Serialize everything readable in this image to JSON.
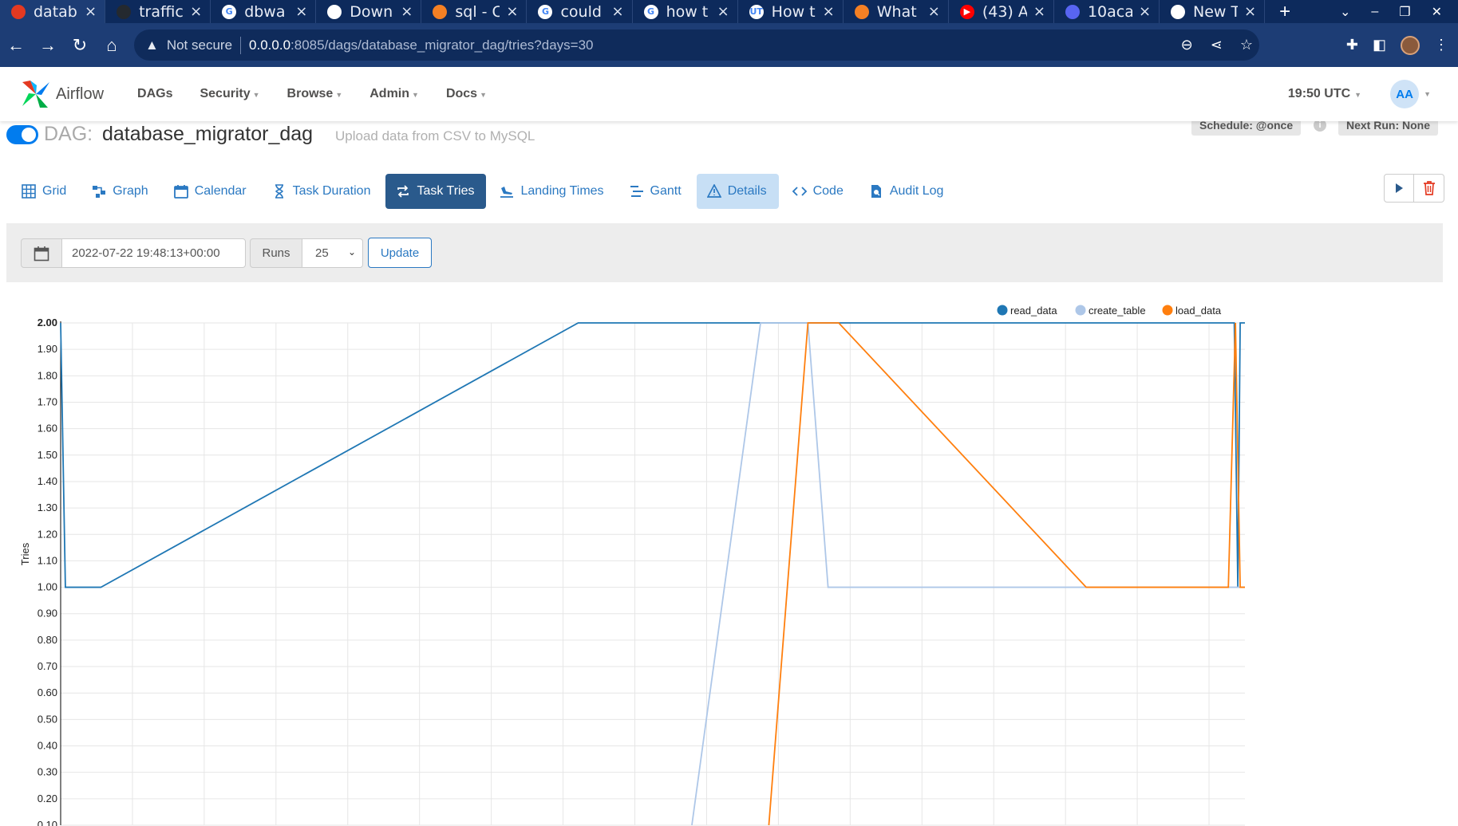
{
  "browser": {
    "tabs": [
      {
        "title": "datab",
        "fav_color": "#e43921",
        "fav_text": ""
      },
      {
        "title": "traffic",
        "fav_color": "#24292f",
        "fav_text": ""
      },
      {
        "title": "dbwa",
        "fav_color": "#ffffff",
        "fav_text": "G"
      },
      {
        "title": "Down",
        "fav_color": "#ffffff",
        "fav_text": ""
      },
      {
        "title": "sql - C",
        "fav_color": "#f48024",
        "fav_text": ""
      },
      {
        "title": "could",
        "fav_color": "#ffffff",
        "fav_text": "G"
      },
      {
        "title": "how t",
        "fav_color": "#ffffff",
        "fav_text": "G"
      },
      {
        "title": "How t",
        "fav_color": "#ffffff",
        "fav_text": "UT"
      },
      {
        "title": "What",
        "fav_color": "#f48024",
        "fav_text": ""
      },
      {
        "title": "(43) A",
        "fav_color": "#ff0000",
        "fav_text": "▶"
      },
      {
        "title": "10aca",
        "fav_color": "#5865f2",
        "fav_text": ""
      },
      {
        "title": "New T",
        "fav_color": "#ffffff",
        "fav_text": ""
      }
    ],
    "address": {
      "security": "Not secure",
      "host": "0.0.0.0",
      "path": ":8085/dags/database_migrator_dag/tries?days=30"
    }
  },
  "header": {
    "logo_text": "Airflow",
    "menu": [
      "DAGs",
      "Security",
      "Browse",
      "Admin",
      "Docs"
    ],
    "clock": "19:50 UTC",
    "avatar": "AA"
  },
  "dag": {
    "prefix": "DAG:",
    "name": "database_migrator_dag",
    "description": "Upload data from CSV to MySQL",
    "schedule": "Schedule: @once",
    "info": "i",
    "next_run": "Next Run: None"
  },
  "tabs": [
    {
      "label": "Grid",
      "icon": "grid-icon"
    },
    {
      "label": "Graph",
      "icon": "graph-icon"
    },
    {
      "label": "Calendar",
      "icon": "calendar-icon"
    },
    {
      "label": "Task Duration",
      "icon": "hourglass-icon"
    },
    {
      "label": "Task Tries",
      "icon": "retry-icon"
    },
    {
      "label": "Landing Times",
      "icon": "landing-icon"
    },
    {
      "label": "Gantt",
      "icon": "gantt-icon"
    },
    {
      "label": "Details",
      "icon": "warning-icon"
    },
    {
      "label": "Code",
      "icon": "code-icon"
    },
    {
      "label": "Audit Log",
      "icon": "audit-icon"
    }
  ],
  "filter": {
    "base_date": "2022-07-22 19:48:13+00:00",
    "runs_label": "Runs",
    "runs_value": "25",
    "update_label": "Update"
  },
  "colors": {
    "accent": "#017cee",
    "active_tab": "#2a5a8c",
    "details_tab": "#c7dff5",
    "read_data": "#1f77b4",
    "create_table": "#aec7e8",
    "load_data": "#ff7f0e"
  },
  "chart_data": {
    "type": "line",
    "ylabel": "Tries",
    "ylim": [
      0.1,
      2.0
    ],
    "yticks": [
      "2.00",
      "1.90",
      "1.80",
      "1.70",
      "1.60",
      "1.50",
      "1.40",
      "1.30",
      "1.20",
      "1.10",
      "1.00",
      "0.90",
      "0.80",
      "0.70",
      "0.60",
      "0.50",
      "0.40",
      "0.30",
      "0.20",
      "0.10"
    ],
    "legend_position": "top-right",
    "grid": true,
    "series": [
      {
        "name": "read_data",
        "color": "#1f77b4",
        "points": [
          [
            0.0,
            2.0
          ],
          [
            0.4,
            1.0
          ],
          [
            3.4,
            1.0
          ],
          [
            43.7,
            2.0
          ],
          [
            99.1,
            2.0
          ],
          [
            99.4,
            1.0
          ],
          [
            99.6,
            2.0
          ],
          [
            100,
            2.0
          ]
        ]
      },
      {
        "name": "create_table",
        "color": "#aec7e8",
        "points": [
          [
            53.3,
            0.1
          ],
          [
            59.1,
            2.0
          ],
          [
            63.1,
            2.0
          ],
          [
            64.8,
            1.0
          ],
          [
            99.4,
            1.0
          ],
          [
            100,
            1.0
          ]
        ]
      },
      {
        "name": "load_data",
        "color": "#ff7f0e",
        "points": [
          [
            59.8,
            0.1
          ],
          [
            63.1,
            2.0
          ],
          [
            65.7,
            2.0
          ],
          [
            86.6,
            1.0
          ],
          [
            98.6,
            1.0
          ],
          [
            99.2,
            2.0
          ],
          [
            99.6,
            1.0
          ],
          [
            100,
            1.0
          ]
        ]
      }
    ]
  }
}
